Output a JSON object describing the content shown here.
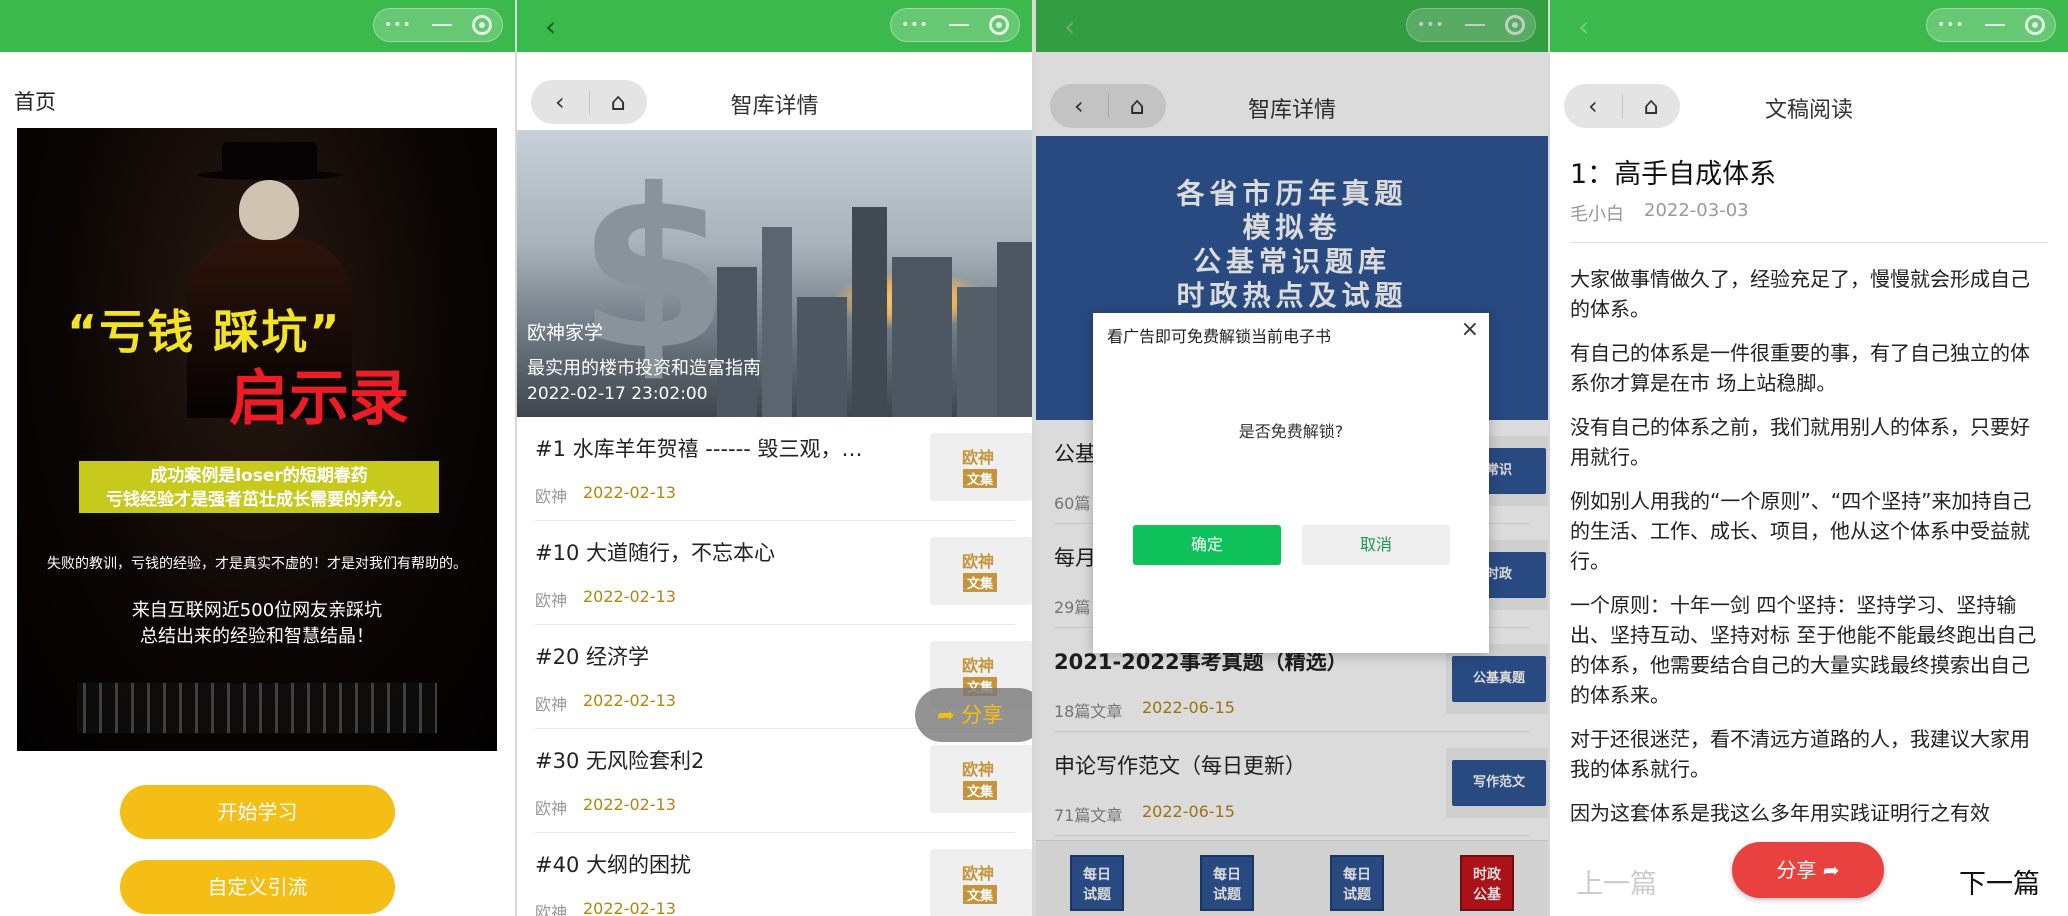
{
  "colors": {
    "wechat_green": "#3cb94c",
    "accent_yellow": "#f5be16",
    "ok_green": "#0ec15b",
    "share_red": "#e94040",
    "date_gold": "#b58512",
    "banner_blue": "#2f5797"
  },
  "capsule": {
    "more": "•••",
    "minimize": "—",
    "close": "◎"
  },
  "panel1": {
    "label": "首页",
    "poster": {
      "title1": "“亏钱 踩坑”",
      "title2": "启示录",
      "band_line1": "成功案例是loser的短期春药",
      "band_line2": "亏钱经验才是强者茁壮成长需要的养分。",
      "line3": "失败的教训，亏钱的经验，才是真实不虚的！才是对我们有帮助的。",
      "line4a": "来自互联网近500位网友亲踩坑",
      "line4b": "总结出来的经验和智慧结晶！"
    },
    "btn_start": "开始学习",
    "btn_custom": "自定义引流"
  },
  "panel2": {
    "nav_back": "‹",
    "title": "智库详情",
    "hero_author": "欧神家学",
    "hero_subtitle": "最实用的楼市投资和造富指南",
    "hero_date": "2022-02-17 23:02:00",
    "articles": [
      {
        "title": "#1 水库羊年贺禧 ------ 毁三观，…",
        "author": "欧神",
        "date": "2022-02-13"
      },
      {
        "title": "#10 大道随行，不忘本心",
        "author": "欧神",
        "date": "2022-02-13"
      },
      {
        "title": "#20 经济学",
        "author": "欧神",
        "date": "2022-02-13"
      },
      {
        "title": "#30 无风险套利2",
        "author": "欧神",
        "date": "2022-02-13"
      },
      {
        "title": "#40 大纲的困扰",
        "author": "欧神",
        "date": "2022-02-13"
      }
    ],
    "thumb_k1": "欧神",
    "thumb_k2": "文集",
    "share": "分享"
  },
  "panel3": {
    "title": "智库详情",
    "banner": [
      "各省市历年真题",
      "模拟卷",
      "公基常识题库",
      "时政热点及试题"
    ],
    "list": [
      {
        "title": "公基",
        "count": "60篇",
        "date": "",
        "badge": "常识"
      },
      {
        "title": "每月",
        "count": "29篇",
        "date": "",
        "badge": "时政"
      },
      {
        "title": "2021-2022事考真题（精选）",
        "count": "18篇文章",
        "date": "2022-06-15",
        "badge": "公基真题"
      },
      {
        "title": "申论写作范文（每日更新）",
        "count": "71篇文章",
        "date": "2022-06-15",
        "badge": "写作范文"
      }
    ],
    "modal": {
      "title": "看广告即可免费解锁当前电子书",
      "close": "×",
      "question": "是否免费解锁?",
      "ok": "确定",
      "cancel": "取消"
    },
    "tabs": [
      {
        "l1": "每日",
        "l2": "试题"
      },
      {
        "l1": "每日",
        "l2": "试题"
      },
      {
        "l1": "每日",
        "l2": "试题"
      },
      {
        "l1": "时政",
        "l2": "公基"
      }
    ]
  },
  "panel4": {
    "title": "文稿阅读",
    "article_title": "1：高手自成体系",
    "author": "毛小白",
    "date": "2022-03-03",
    "paragraphs": [
      "大家做事情做久了，经验充足了，慢慢就会形成自己的体系。",
      "有自己的体系是一件很重要的事，有了自己独立的体系你才算是在市 场上站稳脚。",
      "没有自己的体系之前，我们就用别人的体系，只要好用就行。",
      "例如别人用我的“一个原则”、“四个坚持”来加持自己的生活、工作、成长、项目，他从这个体系中受益就行。",
      "一个原则：十年一剑 四个坚持：坚持学习、坚持输出、坚持互动、坚持对标 至于他能不能最终跑出自己的体系，他需要结合自己的大量实践最终摸索出自己的体系来。",
      "对于还很迷茫，看不清远方道路的人，我建议大家用我的体系就行。",
      "因为这套体系是我这么多年用实践证明行之有效"
    ],
    "prev": "上一篇",
    "next": "下一篇",
    "share": "分享"
  }
}
